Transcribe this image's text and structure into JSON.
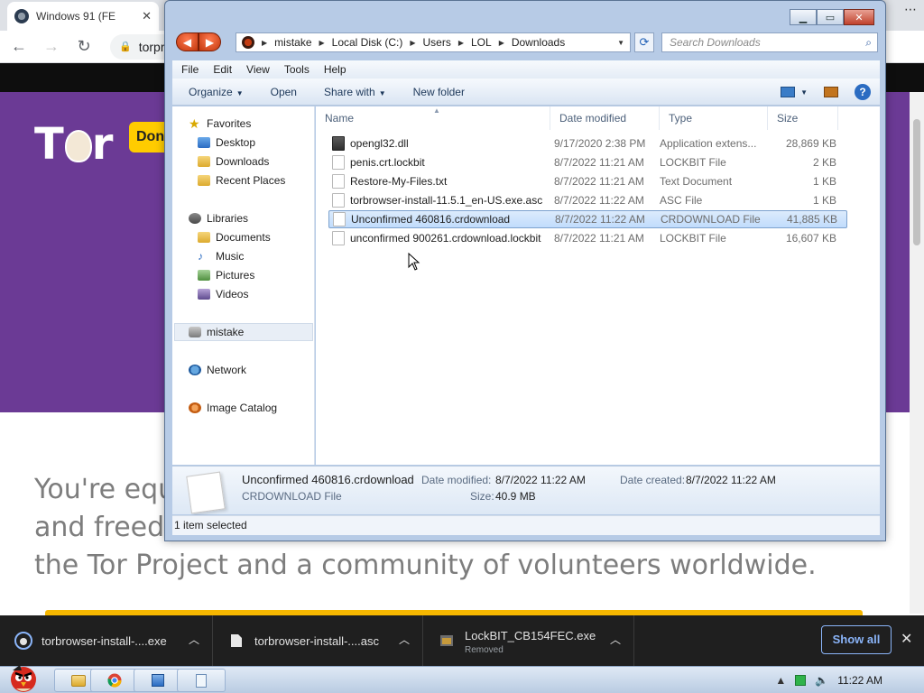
{
  "browser": {
    "tab_title": "Windows 91 (FE",
    "url_text": "torproj",
    "window_controls": "⋯"
  },
  "page": {
    "logo_text": "T r",
    "donate_label": "Don",
    "hero_lines": [
      "You're equ",
      "and freedo",
      "the Tor Project and a community of volunteers worldwide."
    ]
  },
  "explorer": {
    "breadcrumb": [
      "mistake",
      "Local Disk (C:)",
      "Users",
      "LOL",
      "Downloads"
    ],
    "search_placeholder": "Search Downloads",
    "menu": [
      "File",
      "Edit",
      "View",
      "Tools",
      "Help"
    ],
    "commands": {
      "organize": "Organize",
      "open": "Open",
      "share_with": "Share with",
      "new_folder": "New folder"
    },
    "nav": {
      "favorites": "Favorites",
      "desktop": "Desktop",
      "downloads": "Downloads",
      "recent_places": "Recent Places",
      "libraries": "Libraries",
      "documents": "Documents",
      "music": "Music",
      "pictures": "Pictures",
      "videos": "Videos",
      "mistake": "mistake",
      "network": "Network",
      "image_catalog": "Image Catalog"
    },
    "columns": {
      "name": "Name",
      "date": "Date modified",
      "type": "Type",
      "size": "Size"
    },
    "files": [
      {
        "name": "opengl32.dll",
        "date": "9/17/2020 2:38 PM",
        "type": "Application extens...",
        "size": "28,869 KB",
        "icon": "dll-icon"
      },
      {
        "name": "penis.crt.lockbit",
        "date": "8/7/2022 11:21 AM",
        "type": "LOCKBIT File",
        "size": "2 KB",
        "icon": "file-icon"
      },
      {
        "name": "Restore-My-Files.txt",
        "date": "8/7/2022 11:21 AM",
        "type": "Text Document",
        "size": "1 KB",
        "icon": "file-icon"
      },
      {
        "name": "torbrowser-install-11.5.1_en-US.exe.asc",
        "date": "8/7/2022 11:22 AM",
        "type": "ASC File",
        "size": "1 KB",
        "icon": "file-icon"
      },
      {
        "name": "Unconfirmed 460816.crdownload",
        "date": "8/7/2022 11:22 AM",
        "type": "CRDOWNLOAD File",
        "size": "41,885 KB",
        "icon": "file-icon"
      },
      {
        "name": "unconfirmed 900261.crdownload.lockbit",
        "date": "8/7/2022 11:21 AM",
        "type": "LOCKBIT File",
        "size": "16,607 KB",
        "icon": "file-icon"
      }
    ],
    "selected_index": 4,
    "details": {
      "filename": "Unconfirmed 460816.crdownload",
      "filetype": "CRDOWNLOAD File",
      "date_modified_label": "Date modified:",
      "date_modified": "8/7/2022 11:22 AM",
      "date_created_label": "Date created:",
      "date_created": "8/7/2022 11:22 AM",
      "size_label": "Size:",
      "size": "40.9 MB"
    },
    "status": "1 item selected"
  },
  "downloads": {
    "items": [
      {
        "name": "torbrowser-install-....exe",
        "sub": ""
      },
      {
        "name": "torbrowser-install-....asc",
        "sub": ""
      },
      {
        "name": "LockBIT_CB154FEC.exe",
        "sub": "Removed"
      }
    ],
    "show_all": "Show all"
  },
  "taskbar": {
    "clock": "11:22 AM"
  },
  "colors": {
    "tor_purple": "#6b3a95",
    "donate_yellow": "#ffcc00",
    "shelf_bg": "#1f1f1f",
    "show_all_blue": "#8ab4f8"
  }
}
